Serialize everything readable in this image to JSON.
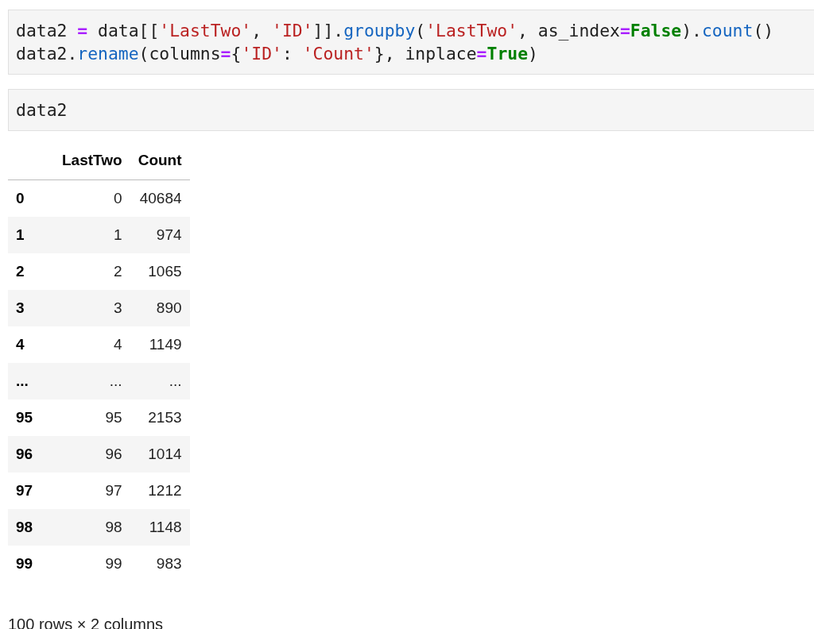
{
  "cells": [
    {
      "lines": [
        [
          {
            "kind": "plain",
            "text": "data2 "
          },
          {
            "kind": "op",
            "text": "="
          },
          {
            "kind": "plain",
            "text": " data[["
          },
          {
            "kind": "string",
            "text": "'LastTwo'"
          },
          {
            "kind": "plain",
            "text": ", "
          },
          {
            "kind": "string",
            "text": "'ID'"
          },
          {
            "kind": "plain",
            "text": "]]."
          },
          {
            "kind": "func",
            "text": "groupby"
          },
          {
            "kind": "plain",
            "text": "("
          },
          {
            "kind": "string",
            "text": "'LastTwo'"
          },
          {
            "kind": "plain",
            "text": ", as_index"
          },
          {
            "kind": "op",
            "text": "="
          },
          {
            "kind": "keyword",
            "text": "False"
          },
          {
            "kind": "plain",
            "text": ")."
          },
          {
            "kind": "func",
            "text": "count"
          },
          {
            "kind": "plain",
            "text": "()"
          }
        ],
        [
          {
            "kind": "plain",
            "text": "data2."
          },
          {
            "kind": "func",
            "text": "rename"
          },
          {
            "kind": "plain",
            "text": "(columns"
          },
          {
            "kind": "op",
            "text": "="
          },
          {
            "kind": "plain",
            "text": "{"
          },
          {
            "kind": "string",
            "text": "'ID'"
          },
          {
            "kind": "plain",
            "text": ": "
          },
          {
            "kind": "string",
            "text": "'Count'"
          },
          {
            "kind": "plain",
            "text": "}, inplace"
          },
          {
            "kind": "op",
            "text": "="
          },
          {
            "kind": "keyword",
            "text": "True"
          },
          {
            "kind": "plain",
            "text": ")"
          }
        ]
      ]
    },
    {
      "lines": [
        [
          {
            "kind": "plain",
            "text": "data2"
          }
        ]
      ]
    }
  ],
  "table": {
    "columns": [
      "LastTwo",
      "Count"
    ],
    "rows": [
      {
        "index": "0",
        "cells": [
          "0",
          "40684"
        ]
      },
      {
        "index": "1",
        "cells": [
          "1",
          "974"
        ]
      },
      {
        "index": "2",
        "cells": [
          "2",
          "1065"
        ]
      },
      {
        "index": "3",
        "cells": [
          "3",
          "890"
        ]
      },
      {
        "index": "4",
        "cells": [
          "4",
          "1149"
        ]
      },
      {
        "index": "...",
        "cells": [
          "...",
          "..."
        ]
      },
      {
        "index": "95",
        "cells": [
          "95",
          "2153"
        ]
      },
      {
        "index": "96",
        "cells": [
          "96",
          "1014"
        ]
      },
      {
        "index": "97",
        "cells": [
          "97",
          "1212"
        ]
      },
      {
        "index": "98",
        "cells": [
          "98",
          "1148"
        ]
      },
      {
        "index": "99",
        "cells": [
          "99",
          "983"
        ]
      }
    ]
  },
  "summary": "100 rows × 2 columns"
}
